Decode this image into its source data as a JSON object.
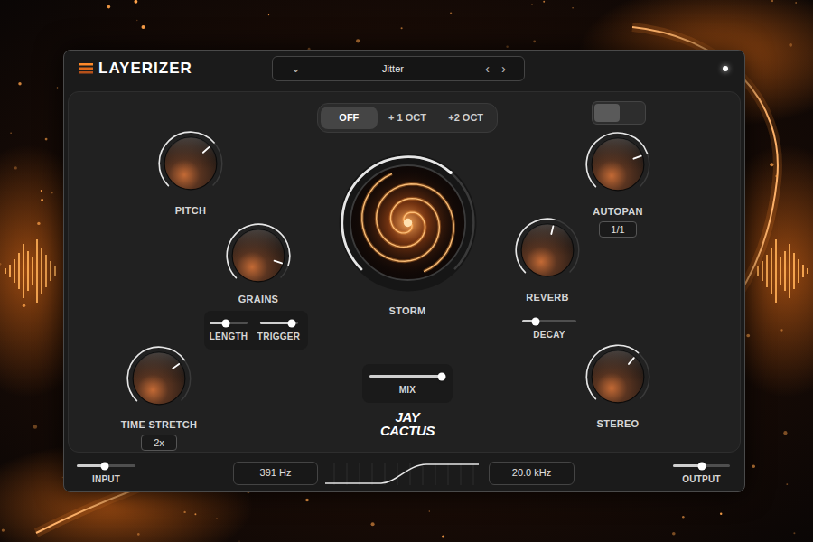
{
  "header": {
    "title": "LAYERIZER",
    "preset": {
      "name": "Jitter",
      "menu": "⌄",
      "prev": "‹",
      "next": "›"
    }
  },
  "octave": [
    {
      "label": "OFF",
      "selected": true
    },
    {
      "label": "+ 1 OCT",
      "selected": false
    },
    {
      "label": "+2 OCT",
      "selected": false
    }
  ],
  "toggle": {
    "on": false
  },
  "knobs": {
    "pitch": {
      "label": "PITCH",
      "level": 0.68
    },
    "grains": {
      "label": "GRAINS",
      "level": 0.9
    },
    "time_stretch": {
      "label": "TIME STRETCH",
      "level": 0.7,
      "value": "2x"
    },
    "storm": {
      "label": "STORM",
      "level": 0.65
    },
    "autopan": {
      "label": "AUTOPAN",
      "level": 0.76,
      "value": "1/1"
    },
    "reverb": {
      "label": "REVERB",
      "level": 0.55
    },
    "stereo": {
      "label": "STEREO",
      "level": 0.65
    }
  },
  "sliders": {
    "length": {
      "label": "LENGTH",
      "level": 0.42
    },
    "trigger": {
      "label": "TRIGGER",
      "level": 0.85
    },
    "decay": {
      "label": "DECAY",
      "level": 0.25
    },
    "mix": {
      "label": "MIX",
      "level": 0.95
    },
    "input": {
      "label": "INPUT",
      "level": 0.48
    },
    "output": {
      "label": "OUTPUT",
      "level": 0.5
    }
  },
  "filter": {
    "low": "391 Hz",
    "high": "20.0 kHz"
  },
  "brand": [
    "JAY",
    "CACTUS"
  ]
}
